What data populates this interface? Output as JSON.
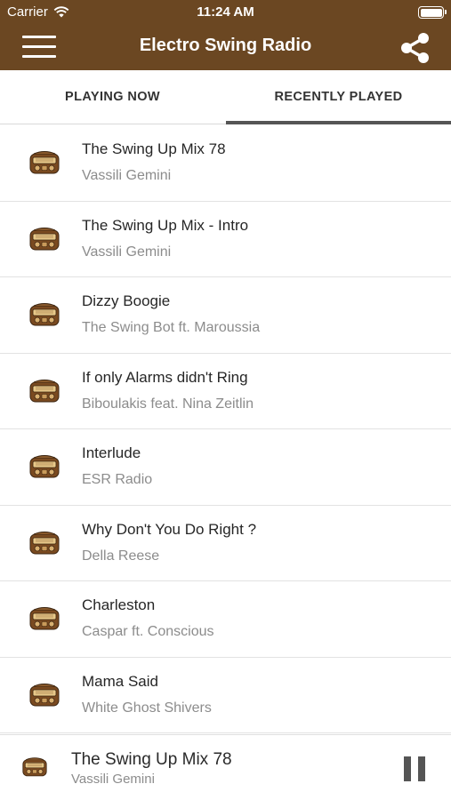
{
  "status_bar": {
    "carrier": "Carrier",
    "time": "11:24 AM"
  },
  "header": {
    "title": "Electro Swing Radio"
  },
  "tabs": [
    {
      "label": "PLAYING NOW",
      "selected": false
    },
    {
      "label": "RECENTLY PLAYED",
      "selected": true
    }
  ],
  "recently_played": [
    {
      "song": "The Swing Up Mix 78",
      "artist": "Vassili Gemini"
    },
    {
      "song": "The Swing Up Mix - Intro",
      "artist": "Vassili Gemini"
    },
    {
      "song": "Dizzy Boogie",
      "artist": "The Swing Bot ft. Maroussia"
    },
    {
      "song": "If only Alarms didn't Ring",
      "artist": "Biboulakis feat. Nina Zeitlin"
    },
    {
      "song": "Interlude",
      "artist": "ESR Radio"
    },
    {
      "song": "Why Don't You Do Right ?",
      "artist": "Della Reese"
    },
    {
      "song": "Charleston",
      "artist": "Caspar ft. Conscious"
    },
    {
      "song": "Mama Said",
      "artist": "White Ghost Shivers"
    }
  ],
  "now_playing": {
    "song": "The Swing Up Mix 78",
    "artist": "Vassili Gemini",
    "state": "playing"
  },
  "icons": {
    "menu": "hamburger-icon",
    "share": "share-icon",
    "track": "vintage-radio-icon",
    "pause": "pause-icon",
    "wifi": "wifi-icon",
    "battery": "battery-icon"
  },
  "colors": {
    "brand": "#6b4722",
    "tab_indicator": "#555555",
    "secondary_text": "#8c8c8c"
  }
}
